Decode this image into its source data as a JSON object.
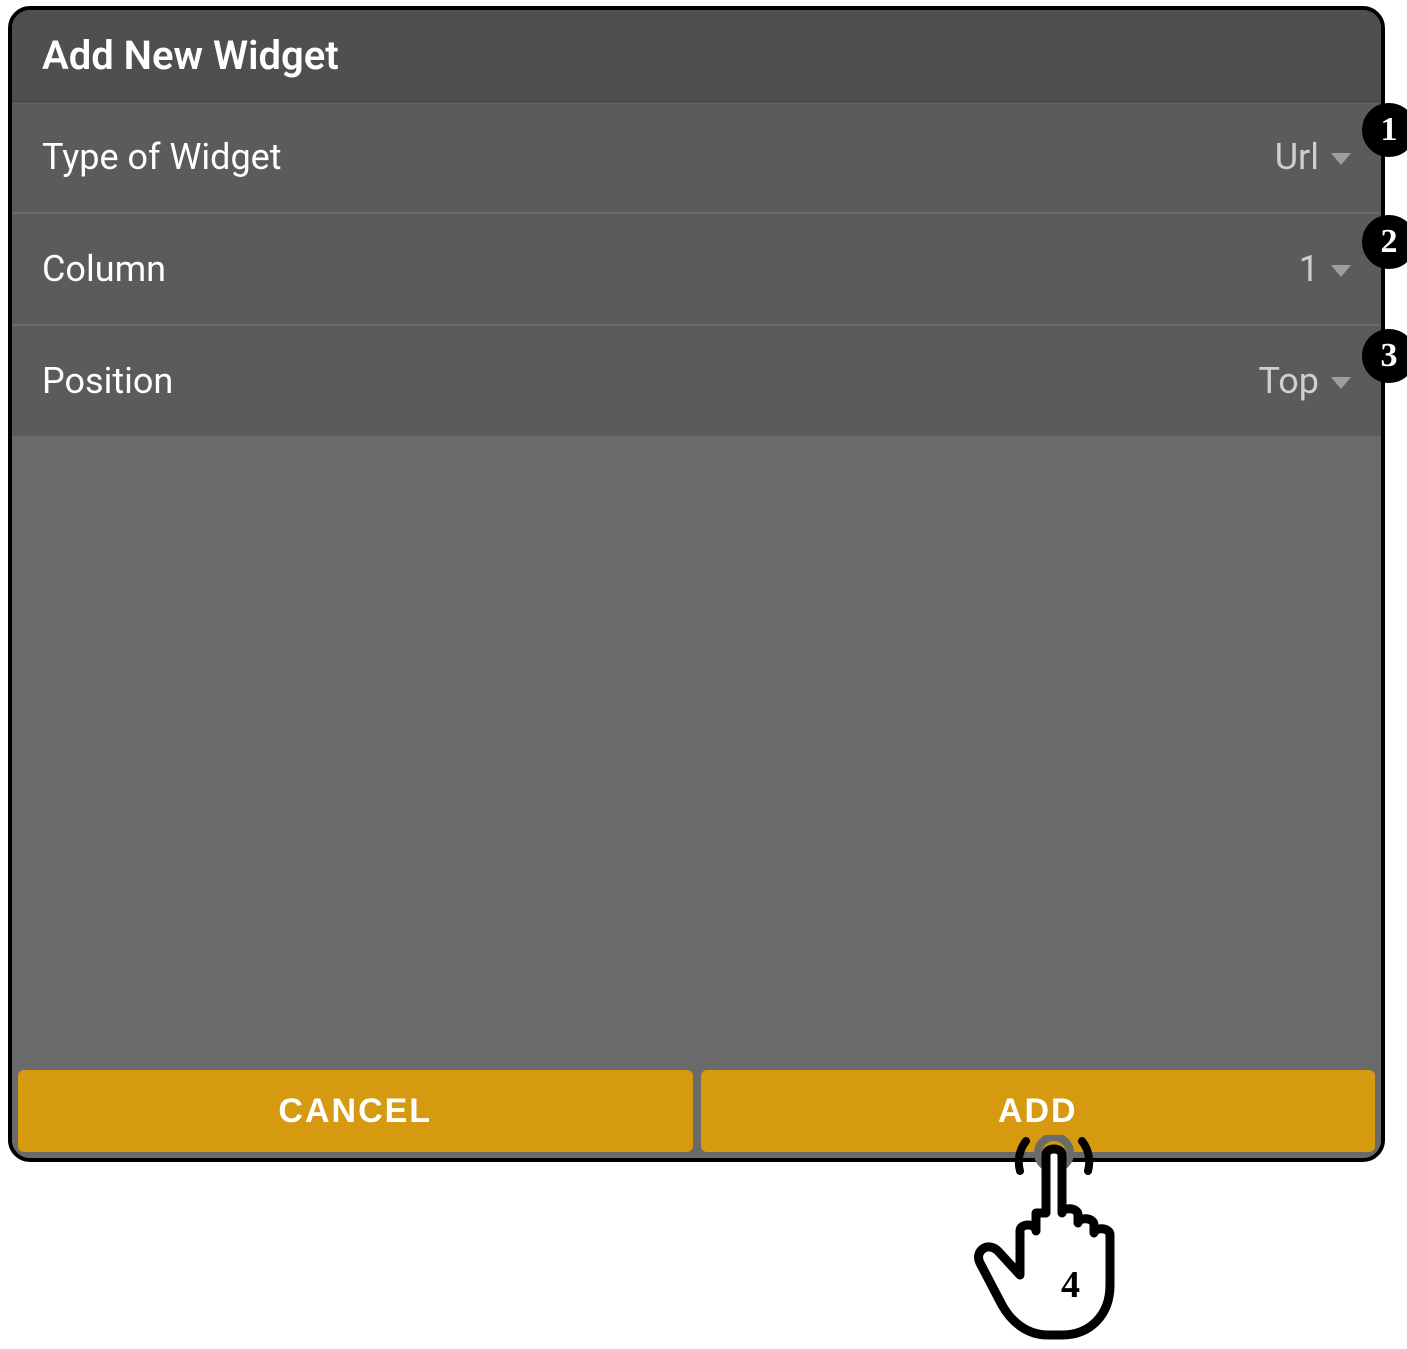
{
  "dialog": {
    "title": "Add New Widget",
    "rows": [
      {
        "label": "Type of Widget",
        "value": "Url"
      },
      {
        "label": "Column",
        "value": "1"
      },
      {
        "label": "Position",
        "value": "Top"
      }
    ],
    "buttons": {
      "cancel": "CANCEL",
      "add": "ADD"
    }
  },
  "callouts": {
    "b1": "1",
    "b2": "2",
    "b3": "3",
    "b4": "4"
  }
}
